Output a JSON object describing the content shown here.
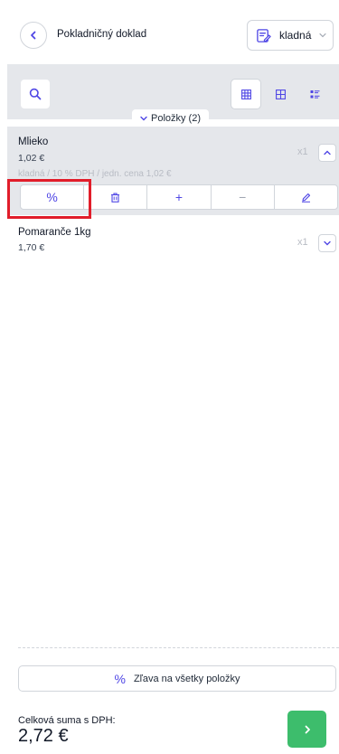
{
  "header": {
    "title": "Pokladničný doklad",
    "document_type": "kladná"
  },
  "items_tab": {
    "label": "Položky (2)"
  },
  "items": [
    {
      "name": "Mlieko",
      "price": "1,02 €",
      "detail": "kladná / 10 % DPH / jedn. cena 1,02 €",
      "quantity": "x1",
      "expanded": true
    },
    {
      "name": "Pomaranče 1kg",
      "price": "1,70 €",
      "quantity": "x1",
      "expanded": false
    }
  ],
  "item_actions": {
    "discount": "%",
    "add": "+",
    "subtract": "−"
  },
  "footer": {
    "discount_all_icon": "%",
    "discount_all_label": "Zľava na všetky položky",
    "total_label": "Celková suma s DPH:",
    "total_value": "2,72 €"
  },
  "colors": {
    "accent": "#4f46e5",
    "confirm": "#3dbd6c",
    "highlight": "#e11d2a"
  }
}
